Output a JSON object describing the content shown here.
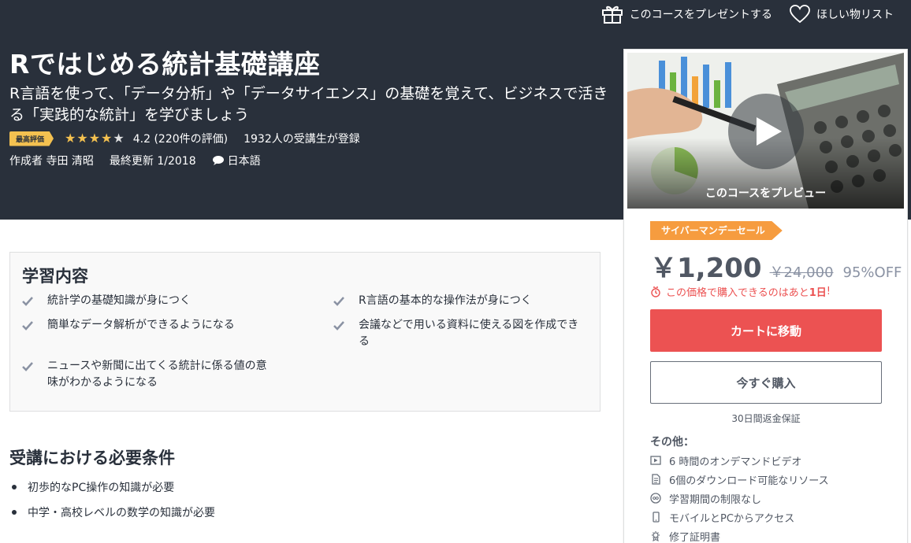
{
  "top_actions": {
    "gift_label": "このコースをプレゼントする",
    "wishlist_label": "ほしい物リスト"
  },
  "course": {
    "title": "Rではじめる統計基礎講座",
    "subtitle": "R言語を使って、「データ分析」や「データサイエンス」の基礎を覚えて、ビジネスで活きる「実践的な統計」を学びましょう",
    "badge": "最高評価",
    "rating": 4.2,
    "rating_text": "4.2 (220件の評価)",
    "students_text": "1932人の受講生が登録",
    "author_text": "作成者 寺田 清昭",
    "updated_text": "最終更新 1/2018",
    "language": "日本語"
  },
  "sidebar": {
    "preview_label": "このコースをプレビュー",
    "sale_tag": "サイバーマンデーセール",
    "price": "￥1,200",
    "original_price": "￥24,000",
    "discount": "95%OFF",
    "deadline_prefix": "この価格で購入できるのはあと",
    "deadline_days": "1日",
    "deadline_suffix": "!",
    "cart_button": "カートに移動",
    "buy_button": "今すぐ購入",
    "guarantee": "30日間返金保証",
    "includes_title": "その他：",
    "includes": [
      "6 時間のオンデマンドビデオ",
      "6個のダウンロード可能なリソース",
      "学習期間の制限なし",
      "モバイルとPCからアクセス",
      "修了証明書"
    ],
    "colors": {
      "accent": "#ec5252",
      "sale": "#f69c3f",
      "star": "#f4c150",
      "header": "#29303b"
    }
  },
  "learn": {
    "title": "学習内容",
    "items": [
      "統計学の基礎知識が身につく",
      "R言語の基本的な操作法が身につく",
      "簡単なデータ解析ができるようになる",
      "会議などで用いる資料に使える図を作成できる",
      "ニュースや新聞に出てくる統計に係る値の意味がわかるようになる"
    ]
  },
  "requirements": {
    "title": "受講における必要条件",
    "items": [
      "初歩的なPC操作の知識が必要",
      "中学・高校レベルの数学の知識が必要"
    ]
  }
}
